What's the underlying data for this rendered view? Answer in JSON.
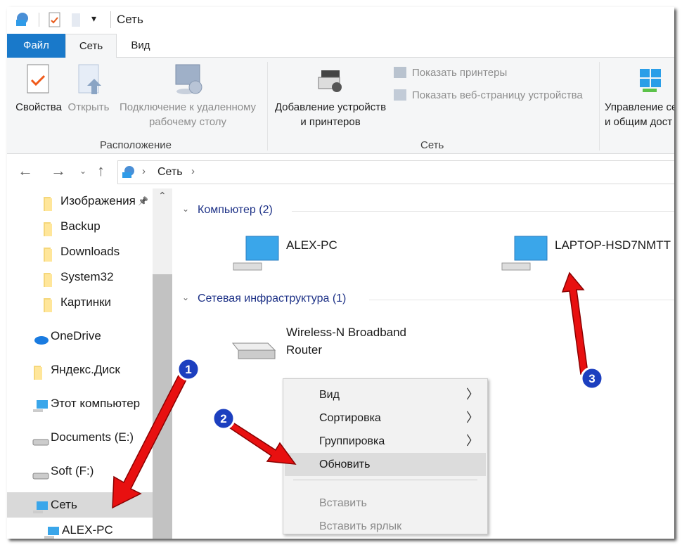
{
  "title_bar": {
    "title": "Сеть"
  },
  "tabs": [
    {
      "label": "Файл",
      "active": false
    },
    {
      "label": "Сеть",
      "active": true
    },
    {
      "label": "Вид",
      "active": false
    }
  ],
  "ribbon": {
    "location": {
      "group_label": "Расположение",
      "properties": "Свойства",
      "open": "Открыть",
      "rdp_line1": "Подключение к удаленному",
      "rdp_line2": "рабочему столу"
    },
    "network": {
      "group_label": "Сеть",
      "add_devices_line1": "Добавление устройств",
      "add_devices_line2": "и принтеров",
      "show_printers": "Показать принтеры",
      "show_web_page": "Показать веб-страницу устройства"
    },
    "manage_line1": "Управление се",
    "manage_line2": "и общим дост"
  },
  "address": {
    "crumb": "Сеть"
  },
  "nav": {
    "items": [
      {
        "label": "Изображения",
        "icon": "pictures-folder-icon"
      },
      {
        "label": "Backup",
        "icon": "folder-icon"
      },
      {
        "label": "Downloads",
        "icon": "folder-icon"
      },
      {
        "label": "System32",
        "icon": "folder-icon"
      },
      {
        "label": "Картинки",
        "icon": "folder-icon"
      },
      {
        "label": "OneDrive",
        "icon": "onedrive-cloud-icon"
      },
      {
        "label": "Яндекс.Диск",
        "icon": "folder-icon"
      },
      {
        "label": "Этот компьютер",
        "icon": "computer-icon"
      },
      {
        "label": "Documents (E:)",
        "icon": "drive-icon"
      },
      {
        "label": "Soft (F:)",
        "icon": "drive-icon"
      },
      {
        "label": "Сеть",
        "icon": "network-icon",
        "selected": true
      },
      {
        "label": "ALEX-PC",
        "icon": "computer-icon"
      }
    ]
  },
  "content": {
    "groups": [
      {
        "label": "Компьютер (2)",
        "items": [
          "ALEX-PC",
          "LAPTOP-HSD7NMTT"
        ]
      },
      {
        "label": "Сетевая инфраструктура (1)",
        "items": [
          "Wireless-N Broadband Router"
        ]
      }
    ],
    "router_line1": "Wireless-N Broadband",
    "router_line2": "Router"
  },
  "context_menu": {
    "items": [
      {
        "label": "Вид",
        "submenu": true
      },
      {
        "label": "Сортировка",
        "submenu": true
      },
      {
        "label": "Группировка",
        "submenu": true
      },
      {
        "label": "Обновить",
        "highlighted": true
      },
      {
        "label": "Вставить",
        "disabled": true
      },
      {
        "label": "Вставить ярлык",
        "disabled": true
      }
    ]
  },
  "annotations": {
    "badges": [
      "1",
      "2",
      "3"
    ],
    "arrow_color": "#e81010",
    "badge_color": "#1c3fbf"
  },
  "colors": {
    "file_tab": "#1979ca",
    "group_header": "#1e3287"
  }
}
